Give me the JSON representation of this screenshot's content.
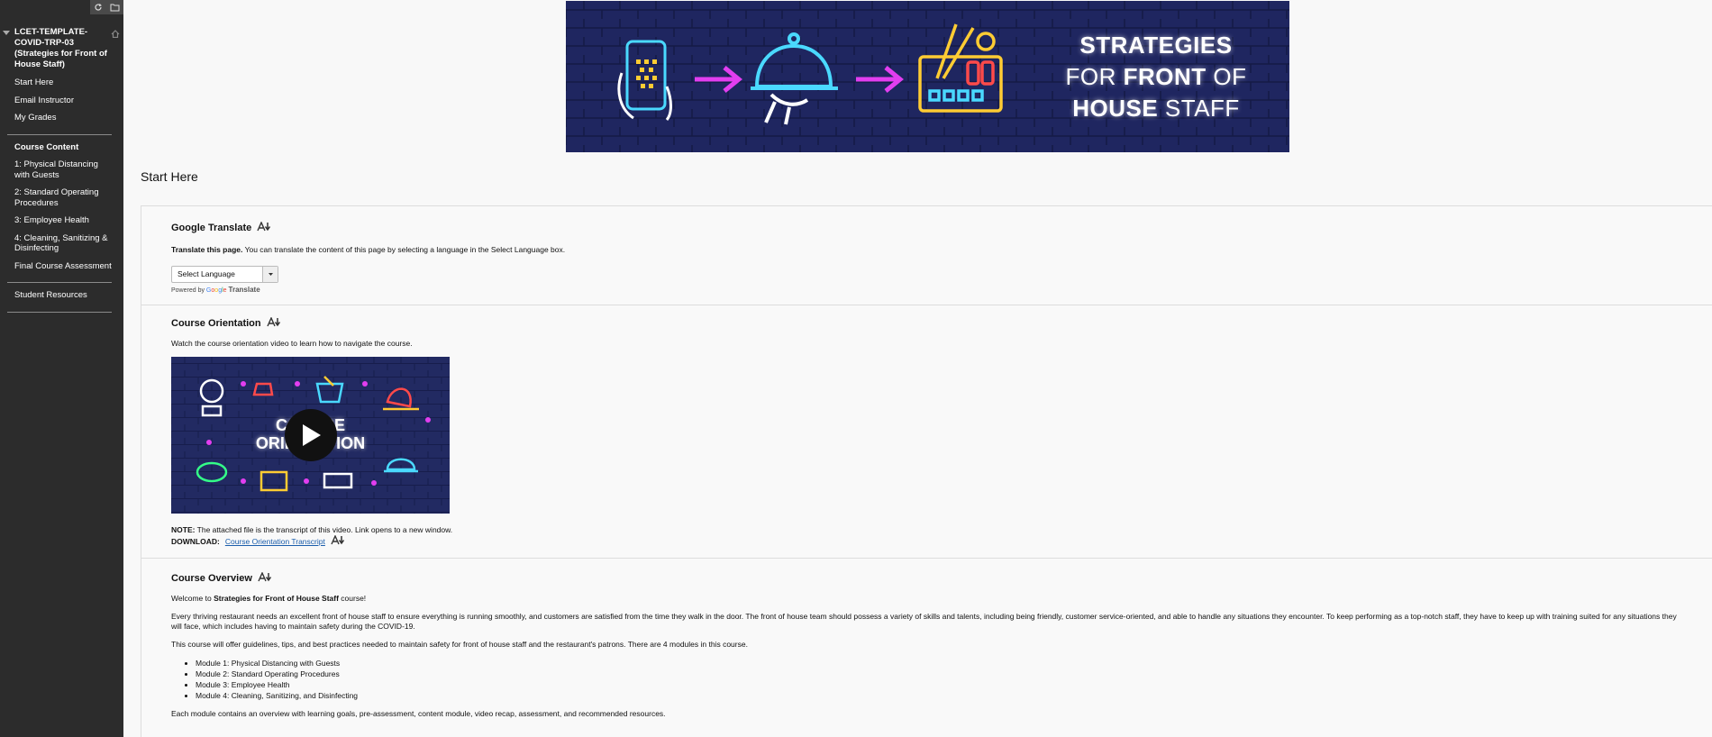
{
  "sidebar": {
    "course_title": "LCET-TEMPLATE-COVID-TRP-03 (Strategies for Front of House Staff)",
    "items_top": [
      "Start Here",
      "Email Instructor",
      "My Grades"
    ],
    "content_heading": "Course Content",
    "items_content": [
      "1: Physical Distancing with Guests",
      "2: Standard Operating Procedures",
      "3: Employee Health",
      "4: Cleaning, Sanitizing & Disinfecting",
      "Final Course Assessment"
    ],
    "items_bottom": [
      "Student Resources"
    ]
  },
  "banner": {
    "line1": "STRATEGIES",
    "line2_a": "FOR ",
    "line2_b": "FRONT",
    "line2_c": " OF",
    "line3_a": "HOUSE",
    "line3_b": " STAFF"
  },
  "page": {
    "title": "Start Here"
  },
  "google_translate": {
    "heading": "Google Translate",
    "intro_bold": "Translate this page.",
    "intro_text": " You can translate the content of this page by selecting a language in the Select Language box.",
    "select_value": "Select Language",
    "powered_by": "Powered by",
    "google": "Google",
    "translate": "Translate"
  },
  "orientation": {
    "heading": "Course Orientation",
    "text": "Watch the course orientation video to learn how to navigate the course.",
    "video_title_1": "COURSE",
    "video_title_2": "ORIENTATION",
    "note_label": "NOTE:",
    "note_text": " The attached file is the transcript of this video. Link opens to a new window.",
    "download_label": "DOWNLOAD:",
    "download_link": "Course Orientation Transcript"
  },
  "overview": {
    "heading": "Course Overview",
    "welcome_a": "Welcome to ",
    "welcome_b": "Strategies for Front of House Staff",
    "welcome_c": " course!",
    "para1": "Every thriving restaurant needs an excellent front of house staff to ensure everything is running smoothly, and customers are satisfied from the time they walk in the door. The front of house team should possess a variety of skills and talents, including being friendly, customer service-oriented, and able to handle any situations they encounter. To keep performing as a top-notch staff, they have to keep up with training suited for any situations they will face, which includes having to maintain safety during the COVID-19.",
    "para2": "This course will offer guidelines, tips, and best practices needed to maintain safety for front of house staff and the restaurant's patrons. There are 4  modules in this course.",
    "modules": [
      "Module 1: Physical Distancing with Guests",
      "Module 2: Standard Operating Procedures",
      "Module 3: Employee Health",
      "Module 4: Cleaning, Sanitizing, and Disinfecting"
    ],
    "para3": "Each module contains an overview with learning goals,  pre-assessment, content module, video recap,  assessment, and recommended resources."
  }
}
